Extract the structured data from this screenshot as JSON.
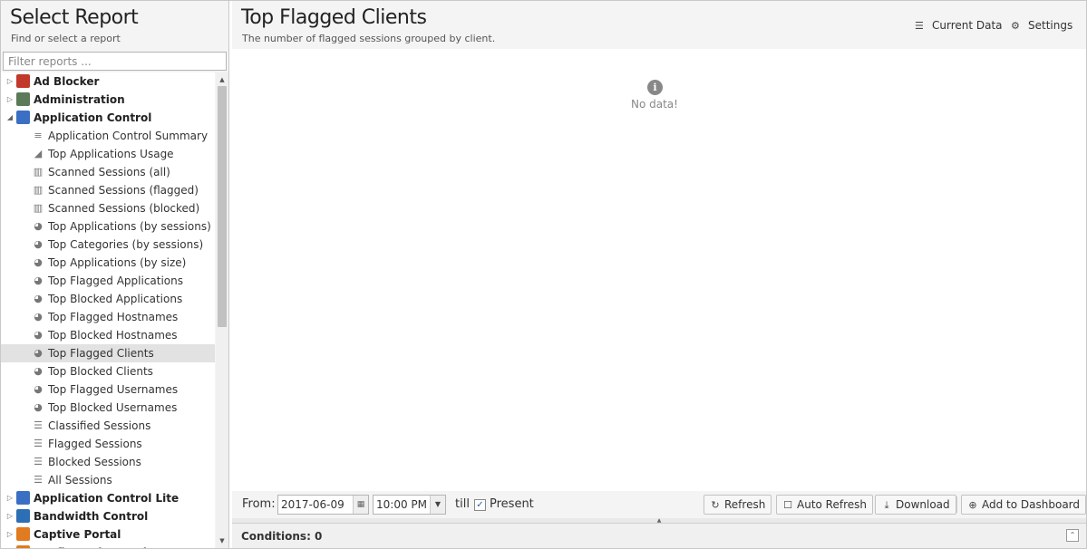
{
  "left": {
    "title": "Select Report",
    "subtitle": "Find or select a report",
    "filter_placeholder": "Filter reports ..."
  },
  "tree": [
    {
      "type": "category",
      "label": "Ad Blocker",
      "expanded": false,
      "icon": "ad-blocker-icon",
      "color": "#c0392b"
    },
    {
      "type": "category",
      "label": "Administration",
      "expanded": false,
      "icon": "administration-icon",
      "color": "#5a7a5a"
    },
    {
      "type": "category",
      "label": "Application Control",
      "expanded": true,
      "icon": "application-control-icon",
      "color": "#3a6fc4"
    },
    {
      "type": "report",
      "label": "Application Control Summary",
      "icon": "text-lines-icon"
    },
    {
      "type": "report",
      "label": "Top Applications Usage",
      "icon": "area-chart-icon"
    },
    {
      "type": "report",
      "label": "Scanned Sessions (all)",
      "icon": "bar-chart-icon"
    },
    {
      "type": "report",
      "label": "Scanned Sessions (flagged)",
      "icon": "bar-chart-icon"
    },
    {
      "type": "report",
      "label": "Scanned Sessions (blocked)",
      "icon": "bar-chart-icon"
    },
    {
      "type": "report",
      "label": "Top Applications (by sessions)",
      "icon": "pie-chart-icon"
    },
    {
      "type": "report",
      "label": "Top Categories (by sessions)",
      "icon": "pie-chart-icon"
    },
    {
      "type": "report",
      "label": "Top Applications (by size)",
      "icon": "pie-chart-icon"
    },
    {
      "type": "report",
      "label": "Top Flagged Applications",
      "icon": "pie-chart-icon"
    },
    {
      "type": "report",
      "label": "Top Blocked Applications",
      "icon": "pie-chart-icon"
    },
    {
      "type": "report",
      "label": "Top Flagged Hostnames",
      "icon": "pie-chart-icon"
    },
    {
      "type": "report",
      "label": "Top Blocked Hostnames",
      "icon": "pie-chart-icon"
    },
    {
      "type": "report",
      "label": "Top Flagged Clients",
      "icon": "pie-chart-icon",
      "selected": true
    },
    {
      "type": "report",
      "label": "Top Blocked Clients",
      "icon": "pie-chart-icon"
    },
    {
      "type": "report",
      "label": "Top Flagged Usernames",
      "icon": "pie-chart-icon"
    },
    {
      "type": "report",
      "label": "Top Blocked Usernames",
      "icon": "pie-chart-icon"
    },
    {
      "type": "report",
      "label": "Classified Sessions",
      "icon": "list-icon"
    },
    {
      "type": "report",
      "label": "Flagged Sessions",
      "icon": "list-icon"
    },
    {
      "type": "report",
      "label": "Blocked Sessions",
      "icon": "list-icon"
    },
    {
      "type": "report",
      "label": "All Sessions",
      "icon": "list-icon"
    },
    {
      "type": "category",
      "label": "Application Control Lite",
      "expanded": false,
      "icon": "application-control-lite-icon",
      "color": "#3a6fc4"
    },
    {
      "type": "category",
      "label": "Bandwidth Control",
      "expanded": false,
      "icon": "bandwidth-control-icon",
      "color": "#2c6fb5"
    },
    {
      "type": "category",
      "label": "Captive Portal",
      "expanded": false,
      "icon": "captive-portal-icon",
      "color": "#e07b20"
    },
    {
      "type": "category",
      "label": "Configuration Backup",
      "expanded": false,
      "icon": "configuration-backup-icon",
      "color": "#e07b20"
    }
  ],
  "report": {
    "title": "Top Flagged Clients",
    "subtitle": "The number of flagged sessions grouped by client.",
    "current_data_label": "Current Data",
    "settings_label": "Settings",
    "no_data_text": "No data!"
  },
  "toolbar": {
    "from_label": "From:",
    "from_date": "2017-06-09",
    "from_time": "10:00 PM",
    "till_label": "till",
    "present_label": "Present",
    "present_checked": true,
    "refresh_label": "Refresh",
    "auto_refresh_label": "Auto Refresh",
    "download_label": "Download",
    "add_dashboard_label": "Add to Dashboard"
  },
  "conditions": {
    "label": "Conditions: 0"
  }
}
